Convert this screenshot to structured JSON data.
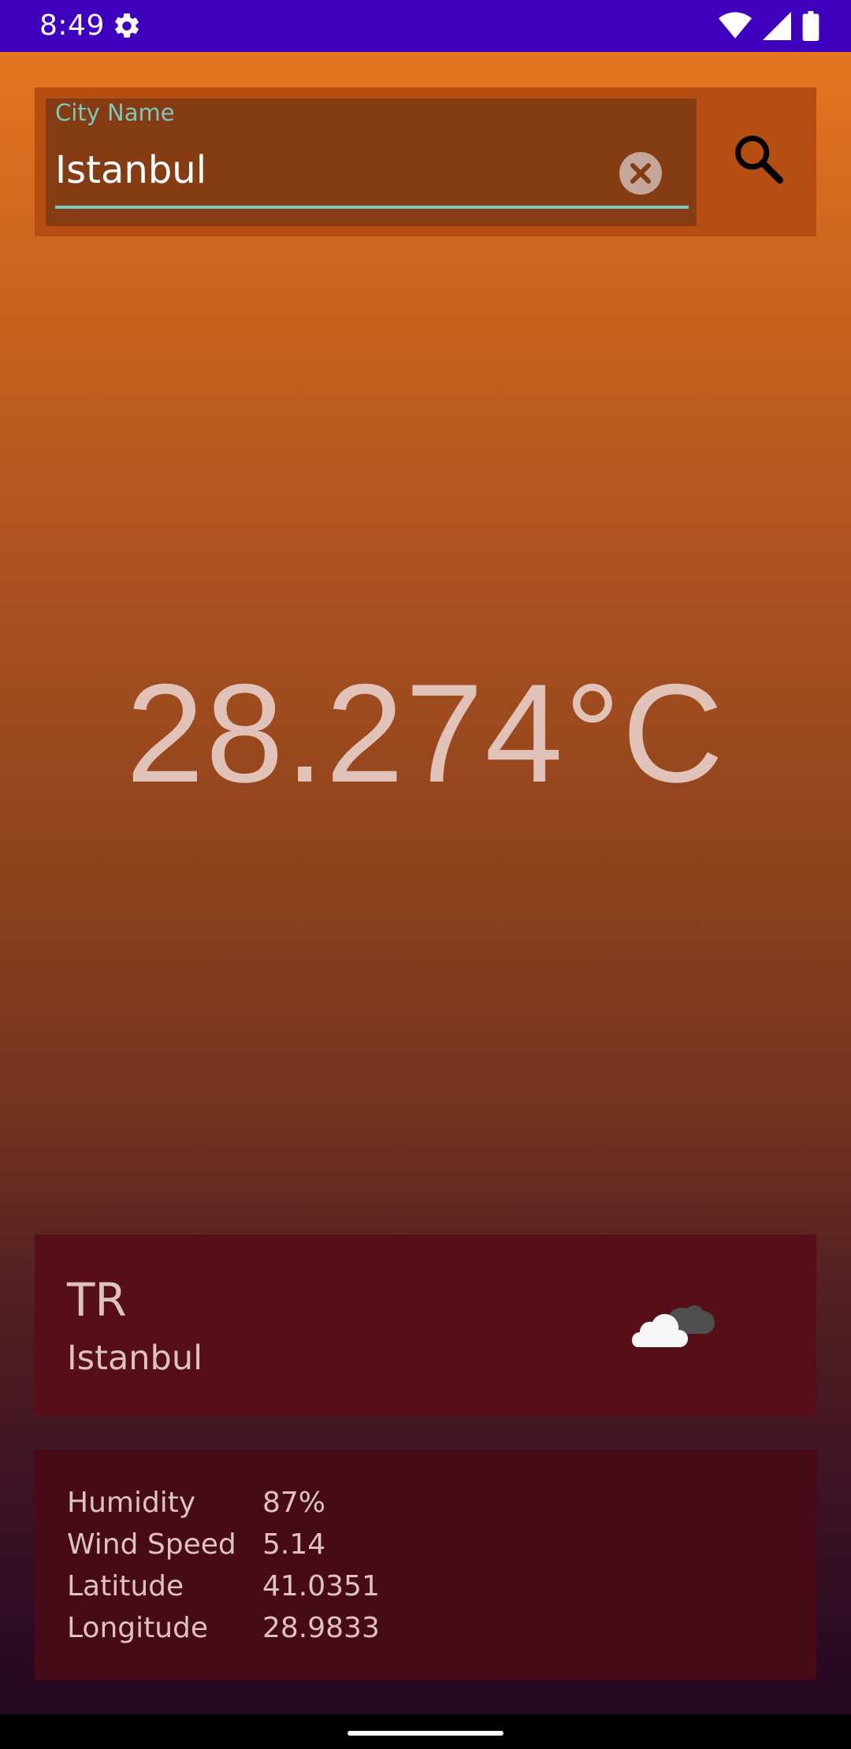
{
  "status_bar": {
    "time": "8:49",
    "icons": [
      "gear-icon",
      "wifi-icon",
      "signal-icon",
      "battery-icon"
    ]
  },
  "search": {
    "label": "City Name",
    "value": "Istanbul",
    "clear_icon": "clear-circle-icon",
    "search_icon": "search-icon"
  },
  "weather": {
    "temperature": "28.274°C",
    "icon": "cloud-icon"
  },
  "location": {
    "country": "TR",
    "city": "Istanbul"
  },
  "details": [
    {
      "label": "Humidity",
      "value": "87%"
    },
    {
      "label": "Wind Speed",
      "value": "5.14"
    },
    {
      "label": "Latitude",
      "value": "41.0351"
    },
    {
      "label": "Longitude",
      "value": "28.9833"
    }
  ],
  "colors": {
    "status_bar": "#3F00BE",
    "accent": "#7EC7BD",
    "gradient_top": "#E5751F",
    "gradient_bottom": "#240721",
    "text_soft": "#DCC3C0"
  }
}
